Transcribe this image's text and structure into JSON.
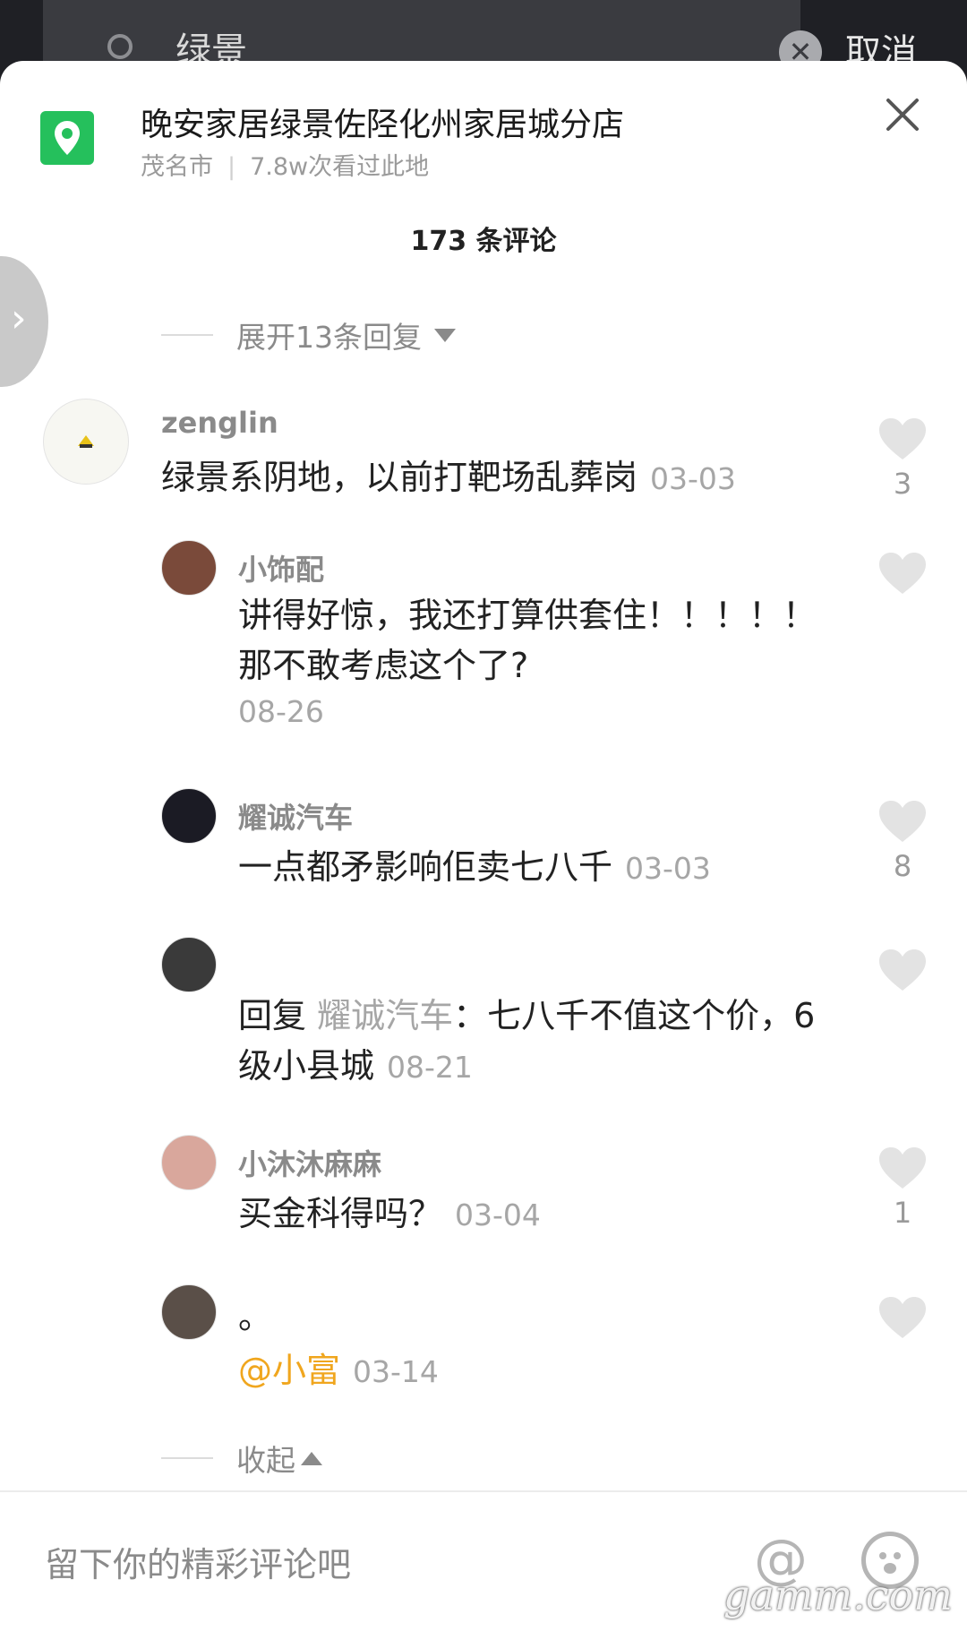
{
  "search": {
    "query": "绿景",
    "cancel_label": "取消",
    "clear_label": "✕"
  },
  "location": {
    "title": "晚安家居绿景佐陉化州家居城分店",
    "city": "茂名市",
    "views": "7.8w次看过此地"
  },
  "comments_header": {
    "count_label": "173 条评论"
  },
  "expand_replies_label": "展开13条回复",
  "collapse_label": "收起",
  "main_comment": {
    "username": "zenglin",
    "text": "绿景系阴地，以前打靶场乱葬岗",
    "date": "03-03",
    "likes": "3"
  },
  "replies": [
    {
      "username": "小饰配",
      "text": "讲得好惊，我还打算供套住！！！！！那不敢考虑这个了?",
      "date": "08-26",
      "likes": ""
    },
    {
      "username": "耀诚汽车",
      "text": "一点都矛影响佢卖七八千",
      "date": "03-03",
      "likes": "8"
    },
    {
      "username": "",
      "reply_prefix": "回复",
      "reply_to": "耀诚汽车",
      "text": "：七八千不值这个价，6级小县城",
      "date": "08-21",
      "likes": ""
    },
    {
      "username": "小沐沐麻麻",
      "text": "买金科得吗？",
      "date": "03-04",
      "likes": "1"
    },
    {
      "username": "",
      "text": "。",
      "mention": "@小富",
      "date": "03-14",
      "likes": ""
    }
  ],
  "input": {
    "placeholder": "留下你的精彩评论吧"
  },
  "watermark": "gamm.com",
  "colors": {
    "location_green": "#25c05c",
    "mention_orange": "#f0a61e"
  }
}
